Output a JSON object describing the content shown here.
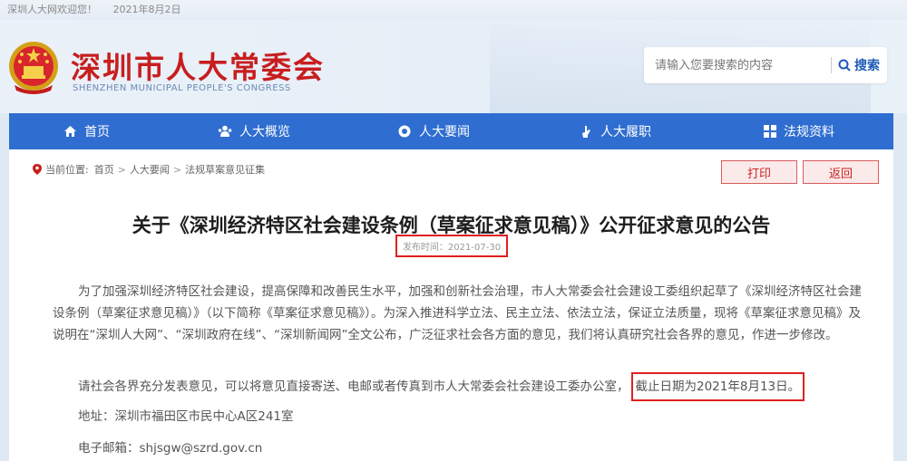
{
  "topbar": {
    "welcome": "深圳人大网欢迎您！",
    "date": "2021年8月2日"
  },
  "header": {
    "title": "深圳市人大常委会",
    "subtitle": "SHENZHEN MUNICIPAL PEOPLE'S CONGRESS",
    "search": {
      "placeholder": "请输入您要搜索的内容",
      "button_label": "搜索"
    }
  },
  "nav": {
    "items": [
      {
        "label": "首页",
        "icon": "home-icon"
      },
      {
        "label": "人大概览",
        "icon": "people-icon"
      },
      {
        "label": "人大要闻",
        "icon": "news-icon"
      },
      {
        "label": "人大履职",
        "icon": "hand-icon"
      },
      {
        "label": "法规资料",
        "icon": "grid-icon"
      }
    ]
  },
  "breadcrumb": {
    "prefix": "当前位置:",
    "items": [
      "首页",
      "人大要闻",
      "法规草案意见征集"
    ]
  },
  "actions": {
    "print_label": "打印",
    "back_label": "返回"
  },
  "article": {
    "title": "关于《深圳经济特区社会建设条例（草案征求意见稿）》公开征求意见的公告",
    "pubdate": "发布时间：2021-07-30",
    "para1": "为了加强深圳经济特区社会建设，提高保障和改善民生水平，加强和创新社会治理，市人大常委会社会建设工委组织起草了《深圳经济特区社会建设条例（草案征求意见稿）》（以下简称《草案征求意见稿》）。为深入推进科学立法、民主立法、依法立法，保证立法质量，现将《草案征求意见稿》及说明在“深圳人大网”、“深圳政府在线”、“深圳新闻网”全文公布，广泛征求社会各方面的意见，我们将认真研究社会各界的意见，作进一步修改。",
    "para2_main": "请社会各界充分发表意见，可以将意见直接寄送、电邮或者传真到市人大常委会社会建设工委办公室，",
    "para2_highlight": "截止日期为2021年8月13日。",
    "address": "地址：深圳市福田区市民中心A区241室",
    "email": "电子邮箱：shjsgw@szrd.gov.cn"
  },
  "colors": {
    "brand_red": "#c81e1e",
    "nav_blue": "#2f6ed0",
    "highlight_red": "#e02020"
  }
}
